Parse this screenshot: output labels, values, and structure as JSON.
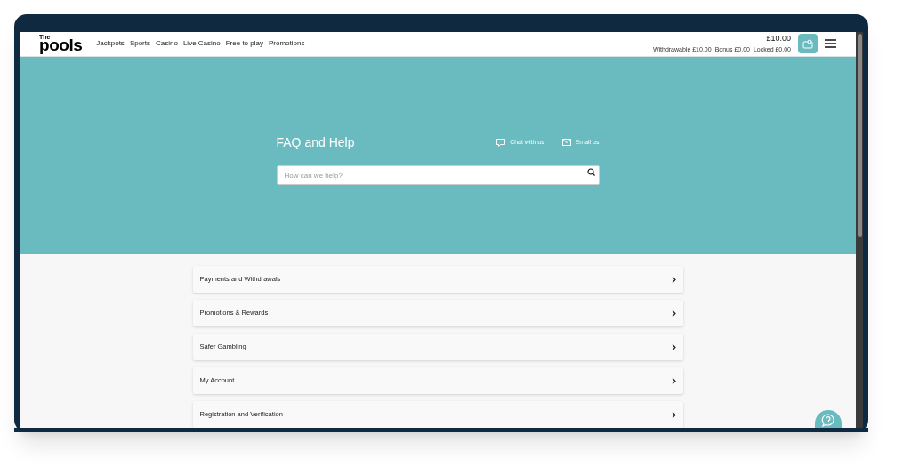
{
  "header": {
    "logo_small": "The",
    "logo": "pools",
    "nav": [
      {
        "label": "Jackpots"
      },
      {
        "label": "Sports"
      },
      {
        "label": "Casino"
      },
      {
        "label": "Live Casino"
      },
      {
        "label": "Free to play"
      },
      {
        "label": "Promotions"
      }
    ],
    "balance": "£10.00",
    "balance_details": [
      {
        "label": "Withdrawable",
        "value": "£10.00"
      },
      {
        "label": "Bonus",
        "value": "£0.00"
      },
      {
        "label": "Locked",
        "value": "£0.00"
      }
    ]
  },
  "hero": {
    "title": "FAQ and Help",
    "contacts": [
      {
        "kind": "chat",
        "label": "Chat with us"
      },
      {
        "kind": "email",
        "label": "Email us"
      }
    ],
    "search": {
      "placeholder": "How can we help?"
    }
  },
  "topics": [
    {
      "label": "Payments and Withdrawals"
    },
    {
      "label": "Promotions & Rewards"
    },
    {
      "label": "Safer Gambling"
    },
    {
      "label": "My Account"
    },
    {
      "label": "Registration and Verification"
    }
  ]
}
